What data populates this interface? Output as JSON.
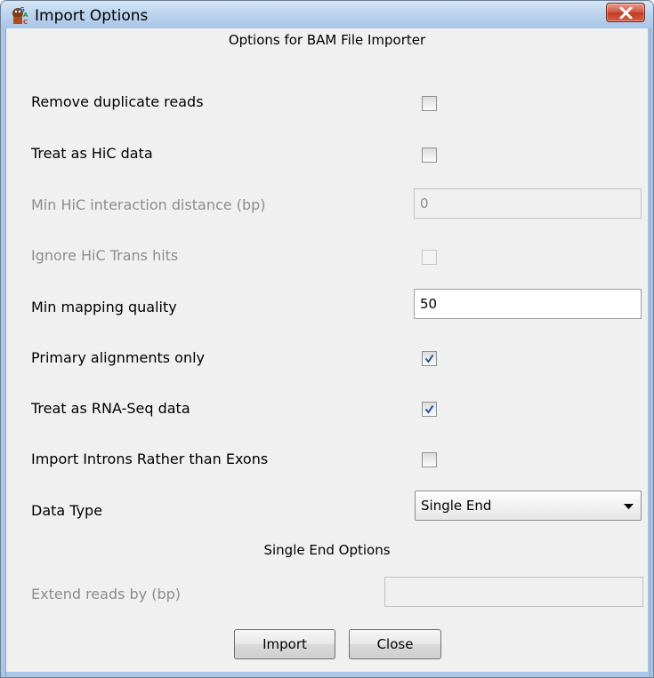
{
  "window": {
    "title": "Import Options",
    "app_icon": "seqmonk-app-icon",
    "close_icon": "close-x-icon",
    "colors": {
      "titlebar": "#bcd4ee",
      "close_button": "#c13b23",
      "panel": "#f0f0f0"
    }
  },
  "section_header": "Options for BAM File Importer",
  "options": {
    "remove_duplicates": {
      "label": "Remove duplicate reads",
      "checked": false,
      "enabled": true
    },
    "treat_hic": {
      "label": "Treat as HiC data",
      "checked": false,
      "enabled": true
    },
    "min_hic_distance": {
      "label": "Min HiC interaction distance (bp)",
      "value": "0",
      "enabled": false
    },
    "ignore_hic_trans": {
      "label": "Ignore HiC Trans hits",
      "checked": false,
      "enabled": false
    },
    "min_mapping_quality": {
      "label": "Min mapping quality",
      "value": "50",
      "enabled": true
    },
    "primary_alignments": {
      "label": "Primary alignments only",
      "checked": true,
      "enabled": true
    },
    "treat_rnaseq": {
      "label": "Treat as RNA-Seq data",
      "checked": true,
      "enabled": true
    },
    "import_introns": {
      "label": "Import Introns Rather than Exons",
      "checked": false,
      "enabled": true
    },
    "data_type": {
      "label": "Data Type",
      "selected": "Single End"
    }
  },
  "single_end": {
    "header": "Single End Options",
    "extend_reads": {
      "label": "Extend reads by (bp)",
      "value": "",
      "enabled": false
    }
  },
  "buttons": {
    "import": "Import",
    "close": "Close"
  }
}
